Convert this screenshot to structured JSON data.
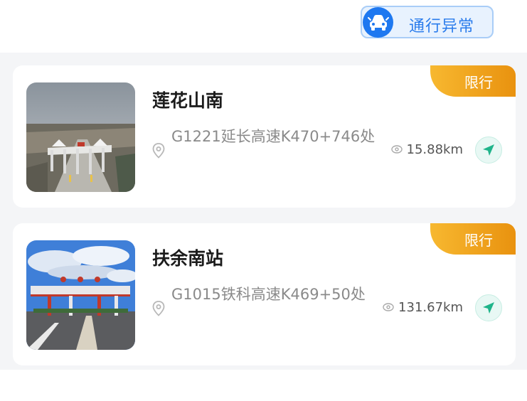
{
  "header": {
    "status_button_label": "通行异常",
    "status_button_icon": "car-warning-icon",
    "accent_color": "#1e78f0"
  },
  "stations": [
    {
      "name": "莲花山南",
      "badge": "限行",
      "address": "G1221延长高速K470+746处",
      "distance": "15.88km",
      "image": "toll-gate-photo-snowy-road",
      "location_icon": "location-pin-icon",
      "nav_icon": "navigate-arrow-icon"
    },
    {
      "name": "扶余南站",
      "badge": "限行",
      "address": "G1015铁科高速K469+50处",
      "distance": "131.67km",
      "image": "toll-gate-photo-blue-sky",
      "location_icon": "location-pin-icon",
      "nav_icon": "navigate-arrow-icon"
    }
  ],
  "colors": {
    "badge_gradient_start": "#f7b830",
    "badge_gradient_end": "#e9920f",
    "nav_green": "#1fb48a",
    "list_background": "#f4f5f7"
  }
}
